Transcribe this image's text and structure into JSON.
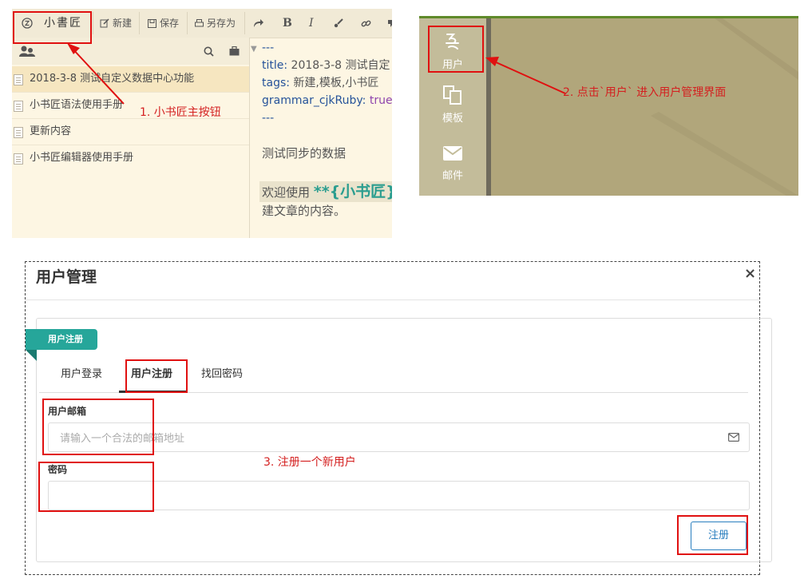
{
  "editor": {
    "toolbar": {
      "app_button": "小書匠",
      "new_label": "新建",
      "save_label": "保存",
      "save_as_label": "另存为",
      "bold_glyph": "B",
      "italic_glyph": "I"
    },
    "files": [
      "2018-3-8 测试自定义数据中心功能",
      "小书匠语法使用手册",
      "更新内容",
      "小书匠编辑器使用手册"
    ],
    "code_lines": {
      "fold_marker": "▼",
      "dashes_top": "---",
      "title_key": "title",
      "title_val": "2018-3-8 测试自定",
      "tags_key": "tags",
      "tags_val": "新建,模板,小书匠",
      "grammar_key": "grammar_cjkRuby",
      "grammar_val": "true",
      "dashes_bottom": "---",
      "body1": "测试同步的数据",
      "welcome_prefix": "欢迎使用 ",
      "welcome_bold": "**{小书匠}",
      "body3": "建文章的内容。"
    }
  },
  "sidebar": {
    "items": [
      {
        "label": "用户",
        "icon": "user-icon"
      },
      {
        "label": "模板",
        "icon": "template-icon"
      },
      {
        "label": "邮件",
        "icon": "mail-icon"
      }
    ]
  },
  "dialog": {
    "title": "用户管理",
    "close_glyph": "×",
    "ribbon": "用户注册",
    "tabs": [
      "用户登录",
      "用户注册",
      "找回密码"
    ],
    "active_tab": "用户注册",
    "email_label": "用户邮箱",
    "email_placeholder": "请输入一个合法的邮箱地址",
    "email_value": "",
    "password_label": "密码",
    "password_value": "",
    "register_button": "注册"
  },
  "annotations": {
    "note1": "1. 小书匠主按钮",
    "note2": "2. 点击`用户` 进入用户管理界面",
    "note3": "3. 注册一个新用户"
  },
  "colors": {
    "accent_teal": "#26a69a",
    "annotation_red": "#e01010",
    "button_blue": "#2a7fbf",
    "editor_bg": "#fdf6e3",
    "sidebar_bg": "#b1a67b"
  }
}
